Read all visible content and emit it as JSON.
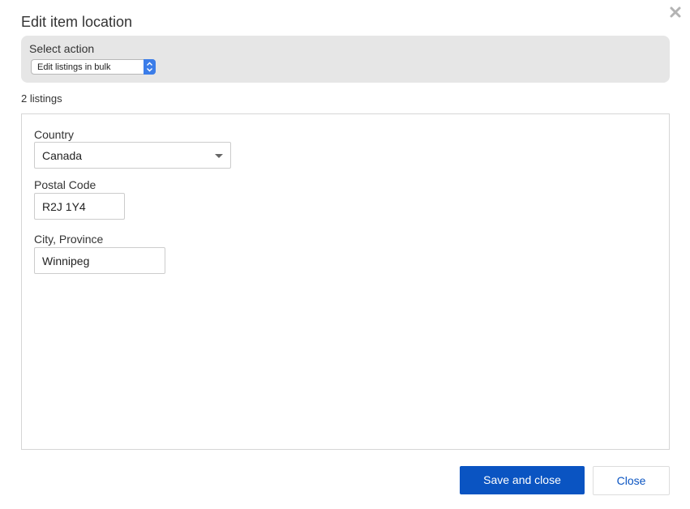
{
  "dialog": {
    "title": "Edit item location",
    "close_icon": "close-icon"
  },
  "action": {
    "label": "Select action",
    "selected": "Edit listings in bulk"
  },
  "listing_count": "2 listings",
  "form": {
    "country": {
      "label": "Country",
      "value": "Canada"
    },
    "postal_code": {
      "label": "Postal Code",
      "value": "R2J 1Y4"
    },
    "city_province": {
      "label": "City, Province",
      "value": "Winnipeg"
    }
  },
  "buttons": {
    "save_label": "Save and close",
    "close_label": "Close"
  },
  "colors": {
    "primary": "#0a54c2",
    "panel_bg": "#e6e6e6",
    "select_accent": "#3b7de9"
  }
}
